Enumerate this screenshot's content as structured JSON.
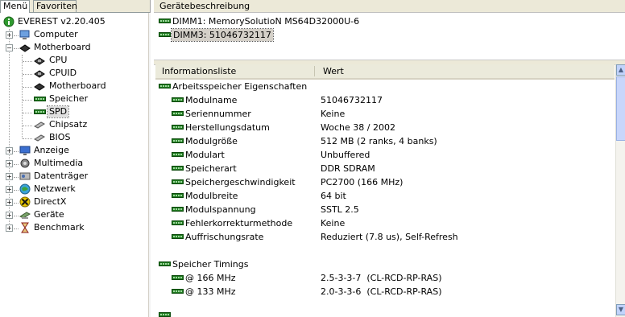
{
  "left": {
    "tabs": [
      "Menü",
      "Favoriten"
    ],
    "tree": [
      {
        "label": "EVEREST v2.20.405",
        "icon": "info-icon"
      },
      {
        "label": "Computer",
        "icon": "computer-icon"
      },
      {
        "label": "Motherboard",
        "icon": "motherboard-icon"
      },
      {
        "label": "CPU",
        "icon": "cpu-icon"
      },
      {
        "label": "CPUID",
        "icon": "cpuid-icon"
      },
      {
        "label": "Motherboard",
        "icon": "motherboard-icon"
      },
      {
        "label": "Speicher",
        "icon": "memory-icon"
      },
      {
        "label": "SPD",
        "icon": "spd-icon"
      },
      {
        "label": "Chipsatz",
        "icon": "chipset-icon"
      },
      {
        "label": "BIOS",
        "icon": "bios-icon"
      },
      {
        "label": "Anzeige",
        "icon": "display-icon"
      },
      {
        "label": "Multimedia",
        "icon": "multimedia-icon"
      },
      {
        "label": "Datenträger",
        "icon": "storage-icon"
      },
      {
        "label": "Netzwerk",
        "icon": "network-icon"
      },
      {
        "label": "DirectX",
        "icon": "directx-icon"
      },
      {
        "label": "Geräte",
        "icon": "devices-icon"
      },
      {
        "label": "Benchmark",
        "icon": "benchmark-icon"
      }
    ]
  },
  "device": {
    "header": "Gerätebeschreibung",
    "items": [
      "DIMM1: MemorySolutioN MS64D32000U-6",
      "DIMM3: 51046732117"
    ]
  },
  "info": {
    "columns": [
      "Informationsliste",
      "Wert"
    ],
    "group1": "Arbeitsspeicher Eigenschaften",
    "props": [
      {
        "name": "Modulname",
        "value": "51046732117"
      },
      {
        "name": "Seriennummer",
        "value": "Keine"
      },
      {
        "name": "Herstellungsdatum",
        "value": "Woche 38 / 2002"
      },
      {
        "name": "Modulgröße",
        "value": "512 MB (2 ranks, 4 banks)"
      },
      {
        "name": "Modulart",
        "value": "Unbuffered"
      },
      {
        "name": "Speicherart",
        "value": "DDR SDRAM"
      },
      {
        "name": "Speichergeschwindigkeit",
        "value": "PC2700 (166 MHz)"
      },
      {
        "name": "Modulbreite",
        "value": "64 bit"
      },
      {
        "name": "Modulspannung",
        "value": "SSTL 2.5"
      },
      {
        "name": "Fehlerkorrekturmethode",
        "value": "Keine"
      },
      {
        "name": "Auffrischungsrate",
        "value": "Reduziert (7.8 us), Self-Refresh"
      }
    ],
    "group2": "Speicher Timings",
    "timings": [
      {
        "name": "@ 166 MHz",
        "value": "2.5-3-3-7  (CL-RCD-RP-RAS)"
      },
      {
        "name": "@ 133 MHz",
        "value": "2.0-3-3-6  (CL-RCD-RP-RAS)"
      }
    ]
  }
}
